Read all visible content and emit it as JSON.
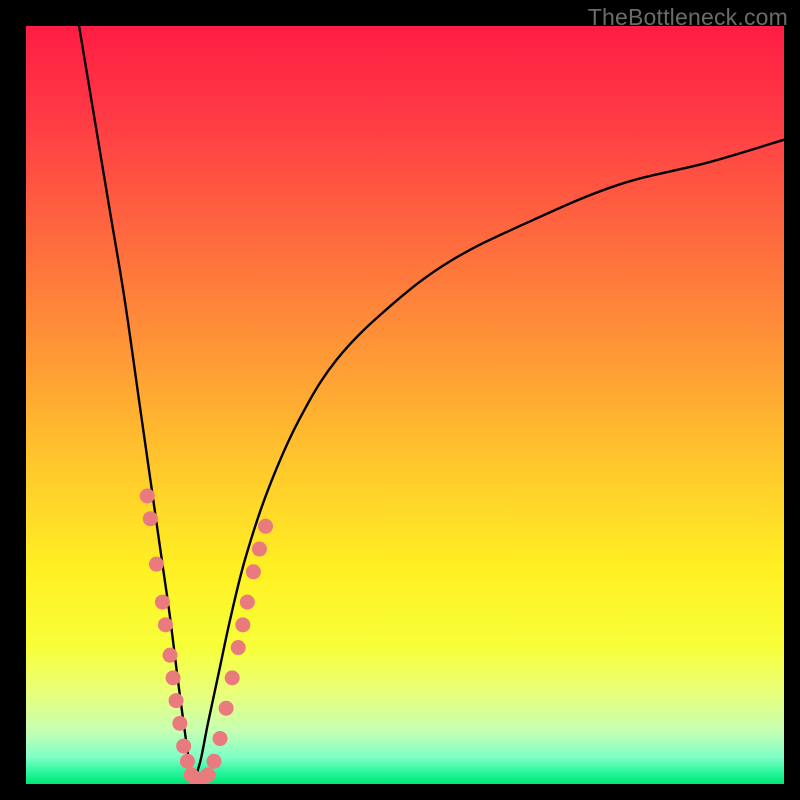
{
  "watermark": "TheBottleneck.com",
  "colors": {
    "bg_black": "#000000",
    "curve_stroke": "#000000",
    "dot_fill": "#e97a7d",
    "gradient_stops": [
      {
        "offset": 0.0,
        "color": "#ff1d44"
      },
      {
        "offset": 0.12,
        "color": "#ff3a45"
      },
      {
        "offset": 0.28,
        "color": "#ff6a3f"
      },
      {
        "offset": 0.44,
        "color": "#ff9a36"
      },
      {
        "offset": 0.58,
        "color": "#ffc82c"
      },
      {
        "offset": 0.72,
        "color": "#fff123"
      },
      {
        "offset": 0.82,
        "color": "#f7ff3a"
      },
      {
        "offset": 0.88,
        "color": "#e9ff7a"
      },
      {
        "offset": 0.93,
        "color": "#c6ffb3"
      },
      {
        "offset": 0.965,
        "color": "#7effc7"
      },
      {
        "offset": 0.985,
        "color": "#27f59a"
      },
      {
        "offset": 1.0,
        "color": "#00e676"
      }
    ]
  },
  "chart_data": {
    "type": "line",
    "title": "",
    "xlabel": "",
    "ylabel": "",
    "xlim": [
      0,
      100
    ],
    "ylim": [
      0,
      100
    ],
    "notes": "Two black curves plunge toward a shared minimum near x≈22 (y≈0) forming a V; left branch rises steeply to y≈100 at x≈7, right branch rises and flattens toward y≈85 at x≈100. Salmon dots cluster along the lower portions of both branches near the trough.",
    "series": [
      {
        "name": "left-branch",
        "x": [
          7,
          9,
          11,
          13,
          15,
          16,
          17,
          18,
          19,
          20,
          20.8,
          21.5,
          22
        ],
        "y": [
          100,
          88,
          76,
          64,
          50,
          43,
          36,
          29,
          22,
          14,
          8,
          3,
          0
        ]
      },
      {
        "name": "right-branch",
        "x": [
          22,
          23,
          24,
          25.5,
          27,
          29,
          32,
          36,
          41,
          48,
          56,
          66,
          78,
          90,
          100
        ],
        "y": [
          0,
          3,
          8,
          15,
          22,
          30,
          39,
          48,
          56,
          63,
          69,
          74,
          79,
          82,
          85
        ]
      }
    ],
    "dots": {
      "name": "highlight-dots",
      "points": [
        {
          "x": 16.0,
          "y": 38
        },
        {
          "x": 16.4,
          "y": 35
        },
        {
          "x": 17.2,
          "y": 29
        },
        {
          "x": 18.0,
          "y": 24
        },
        {
          "x": 18.4,
          "y": 21
        },
        {
          "x": 19.0,
          "y": 17
        },
        {
          "x": 19.4,
          "y": 14
        },
        {
          "x": 19.8,
          "y": 11
        },
        {
          "x": 20.3,
          "y": 8
        },
        {
          "x": 20.8,
          "y": 5
        },
        {
          "x": 21.3,
          "y": 3
        },
        {
          "x": 21.8,
          "y": 1.2
        },
        {
          "x": 22.4,
          "y": 0.6
        },
        {
          "x": 23.2,
          "y": 0.6
        },
        {
          "x": 24.0,
          "y": 1.2
        },
        {
          "x": 24.8,
          "y": 3
        },
        {
          "x": 25.6,
          "y": 6
        },
        {
          "x": 26.4,
          "y": 10
        },
        {
          "x": 27.2,
          "y": 14
        },
        {
          "x": 28.0,
          "y": 18
        },
        {
          "x": 28.6,
          "y": 21
        },
        {
          "x": 29.2,
          "y": 24
        },
        {
          "x": 30.0,
          "y": 28
        },
        {
          "x": 30.8,
          "y": 31
        },
        {
          "x": 31.6,
          "y": 34
        }
      ]
    }
  }
}
